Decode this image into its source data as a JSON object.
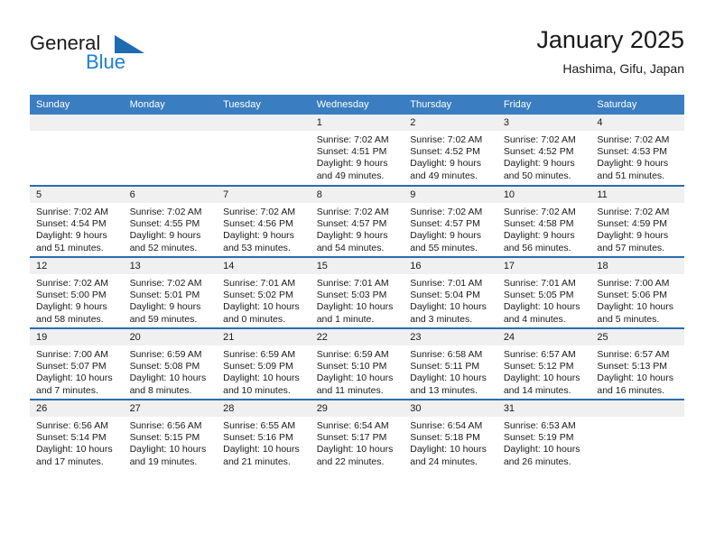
{
  "brand": {
    "name_top": "General",
    "name_bottom": "Blue",
    "triangle_color": "#1e6bb2",
    "blue_color": "#1e7fd4"
  },
  "header": {
    "title": "January 2025",
    "subtitle": "Hashima, Gifu, Japan"
  },
  "colors": {
    "header_bar": "#3a7dc0",
    "week_divider": "#2c6cab",
    "daynum_strip": "#f0f0f0",
    "text": "#1a1a1a"
  },
  "weekdays": [
    "Sunday",
    "Monday",
    "Tuesday",
    "Wednesday",
    "Thursday",
    "Friday",
    "Saturday"
  ],
  "labels": {
    "sunrise_prefix": "Sunrise:",
    "sunset_prefix": "Sunset:",
    "daylight_prefix": "Daylight:"
  },
  "weeks": [
    [
      {
        "day": "",
        "sunrise": "",
        "sunset": "",
        "daylight_line1": "",
        "daylight_line2": ""
      },
      {
        "day": "",
        "sunrise": "",
        "sunset": "",
        "daylight_line1": "",
        "daylight_line2": ""
      },
      {
        "day": "",
        "sunrise": "",
        "sunset": "",
        "daylight_line1": "",
        "daylight_line2": ""
      },
      {
        "day": "1",
        "sunrise": "Sunrise: 7:02 AM",
        "sunset": "Sunset: 4:51 PM",
        "daylight_line1": "Daylight: 9 hours",
        "daylight_line2": "and 49 minutes."
      },
      {
        "day": "2",
        "sunrise": "Sunrise: 7:02 AM",
        "sunset": "Sunset: 4:52 PM",
        "daylight_line1": "Daylight: 9 hours",
        "daylight_line2": "and 49 minutes."
      },
      {
        "day": "3",
        "sunrise": "Sunrise: 7:02 AM",
        "sunset": "Sunset: 4:52 PM",
        "daylight_line1": "Daylight: 9 hours",
        "daylight_line2": "and 50 minutes."
      },
      {
        "day": "4",
        "sunrise": "Sunrise: 7:02 AM",
        "sunset": "Sunset: 4:53 PM",
        "daylight_line1": "Daylight: 9 hours",
        "daylight_line2": "and 51 minutes."
      }
    ],
    [
      {
        "day": "5",
        "sunrise": "Sunrise: 7:02 AM",
        "sunset": "Sunset: 4:54 PM",
        "daylight_line1": "Daylight: 9 hours",
        "daylight_line2": "and 51 minutes."
      },
      {
        "day": "6",
        "sunrise": "Sunrise: 7:02 AM",
        "sunset": "Sunset: 4:55 PM",
        "daylight_line1": "Daylight: 9 hours",
        "daylight_line2": "and 52 minutes."
      },
      {
        "day": "7",
        "sunrise": "Sunrise: 7:02 AM",
        "sunset": "Sunset: 4:56 PM",
        "daylight_line1": "Daylight: 9 hours",
        "daylight_line2": "and 53 minutes."
      },
      {
        "day": "8",
        "sunrise": "Sunrise: 7:02 AM",
        "sunset": "Sunset: 4:57 PM",
        "daylight_line1": "Daylight: 9 hours",
        "daylight_line2": "and 54 minutes."
      },
      {
        "day": "9",
        "sunrise": "Sunrise: 7:02 AM",
        "sunset": "Sunset: 4:57 PM",
        "daylight_line1": "Daylight: 9 hours",
        "daylight_line2": "and 55 minutes."
      },
      {
        "day": "10",
        "sunrise": "Sunrise: 7:02 AM",
        "sunset": "Sunset: 4:58 PM",
        "daylight_line1": "Daylight: 9 hours",
        "daylight_line2": "and 56 minutes."
      },
      {
        "day": "11",
        "sunrise": "Sunrise: 7:02 AM",
        "sunset": "Sunset: 4:59 PM",
        "daylight_line1": "Daylight: 9 hours",
        "daylight_line2": "and 57 minutes."
      }
    ],
    [
      {
        "day": "12",
        "sunrise": "Sunrise: 7:02 AM",
        "sunset": "Sunset: 5:00 PM",
        "daylight_line1": "Daylight: 9 hours",
        "daylight_line2": "and 58 minutes."
      },
      {
        "day": "13",
        "sunrise": "Sunrise: 7:02 AM",
        "sunset": "Sunset: 5:01 PM",
        "daylight_line1": "Daylight: 9 hours",
        "daylight_line2": "and 59 minutes."
      },
      {
        "day": "14",
        "sunrise": "Sunrise: 7:01 AM",
        "sunset": "Sunset: 5:02 PM",
        "daylight_line1": "Daylight: 10 hours",
        "daylight_line2": "and 0 minutes."
      },
      {
        "day": "15",
        "sunrise": "Sunrise: 7:01 AM",
        "sunset": "Sunset: 5:03 PM",
        "daylight_line1": "Daylight: 10 hours",
        "daylight_line2": "and 1 minute."
      },
      {
        "day": "16",
        "sunrise": "Sunrise: 7:01 AM",
        "sunset": "Sunset: 5:04 PM",
        "daylight_line1": "Daylight: 10 hours",
        "daylight_line2": "and 3 minutes."
      },
      {
        "day": "17",
        "sunrise": "Sunrise: 7:01 AM",
        "sunset": "Sunset: 5:05 PM",
        "daylight_line1": "Daylight: 10 hours",
        "daylight_line2": "and 4 minutes."
      },
      {
        "day": "18",
        "sunrise": "Sunrise: 7:00 AM",
        "sunset": "Sunset: 5:06 PM",
        "daylight_line1": "Daylight: 10 hours",
        "daylight_line2": "and 5 minutes."
      }
    ],
    [
      {
        "day": "19",
        "sunrise": "Sunrise: 7:00 AM",
        "sunset": "Sunset: 5:07 PM",
        "daylight_line1": "Daylight: 10 hours",
        "daylight_line2": "and 7 minutes."
      },
      {
        "day": "20",
        "sunrise": "Sunrise: 6:59 AM",
        "sunset": "Sunset: 5:08 PM",
        "daylight_line1": "Daylight: 10 hours",
        "daylight_line2": "and 8 minutes."
      },
      {
        "day": "21",
        "sunrise": "Sunrise: 6:59 AM",
        "sunset": "Sunset: 5:09 PM",
        "daylight_line1": "Daylight: 10 hours",
        "daylight_line2": "and 10 minutes."
      },
      {
        "day": "22",
        "sunrise": "Sunrise: 6:59 AM",
        "sunset": "Sunset: 5:10 PM",
        "daylight_line1": "Daylight: 10 hours",
        "daylight_line2": "and 11 minutes."
      },
      {
        "day": "23",
        "sunrise": "Sunrise: 6:58 AM",
        "sunset": "Sunset: 5:11 PM",
        "daylight_line1": "Daylight: 10 hours",
        "daylight_line2": "and 13 minutes."
      },
      {
        "day": "24",
        "sunrise": "Sunrise: 6:57 AM",
        "sunset": "Sunset: 5:12 PM",
        "daylight_line1": "Daylight: 10 hours",
        "daylight_line2": "and 14 minutes."
      },
      {
        "day": "25",
        "sunrise": "Sunrise: 6:57 AM",
        "sunset": "Sunset: 5:13 PM",
        "daylight_line1": "Daylight: 10 hours",
        "daylight_line2": "and 16 minutes."
      }
    ],
    [
      {
        "day": "26",
        "sunrise": "Sunrise: 6:56 AM",
        "sunset": "Sunset: 5:14 PM",
        "daylight_line1": "Daylight: 10 hours",
        "daylight_line2": "and 17 minutes."
      },
      {
        "day": "27",
        "sunrise": "Sunrise: 6:56 AM",
        "sunset": "Sunset: 5:15 PM",
        "daylight_line1": "Daylight: 10 hours",
        "daylight_line2": "and 19 minutes."
      },
      {
        "day": "28",
        "sunrise": "Sunrise: 6:55 AM",
        "sunset": "Sunset: 5:16 PM",
        "daylight_line1": "Daylight: 10 hours",
        "daylight_line2": "and 21 minutes."
      },
      {
        "day": "29",
        "sunrise": "Sunrise: 6:54 AM",
        "sunset": "Sunset: 5:17 PM",
        "daylight_line1": "Daylight: 10 hours",
        "daylight_line2": "and 22 minutes."
      },
      {
        "day": "30",
        "sunrise": "Sunrise: 6:54 AM",
        "sunset": "Sunset: 5:18 PM",
        "daylight_line1": "Daylight: 10 hours",
        "daylight_line2": "and 24 minutes."
      },
      {
        "day": "31",
        "sunrise": "Sunrise: 6:53 AM",
        "sunset": "Sunset: 5:19 PM",
        "daylight_line1": "Daylight: 10 hours",
        "daylight_line2": "and 26 minutes."
      },
      {
        "day": "",
        "sunrise": "",
        "sunset": "",
        "daylight_line1": "",
        "daylight_line2": ""
      }
    ]
  ]
}
